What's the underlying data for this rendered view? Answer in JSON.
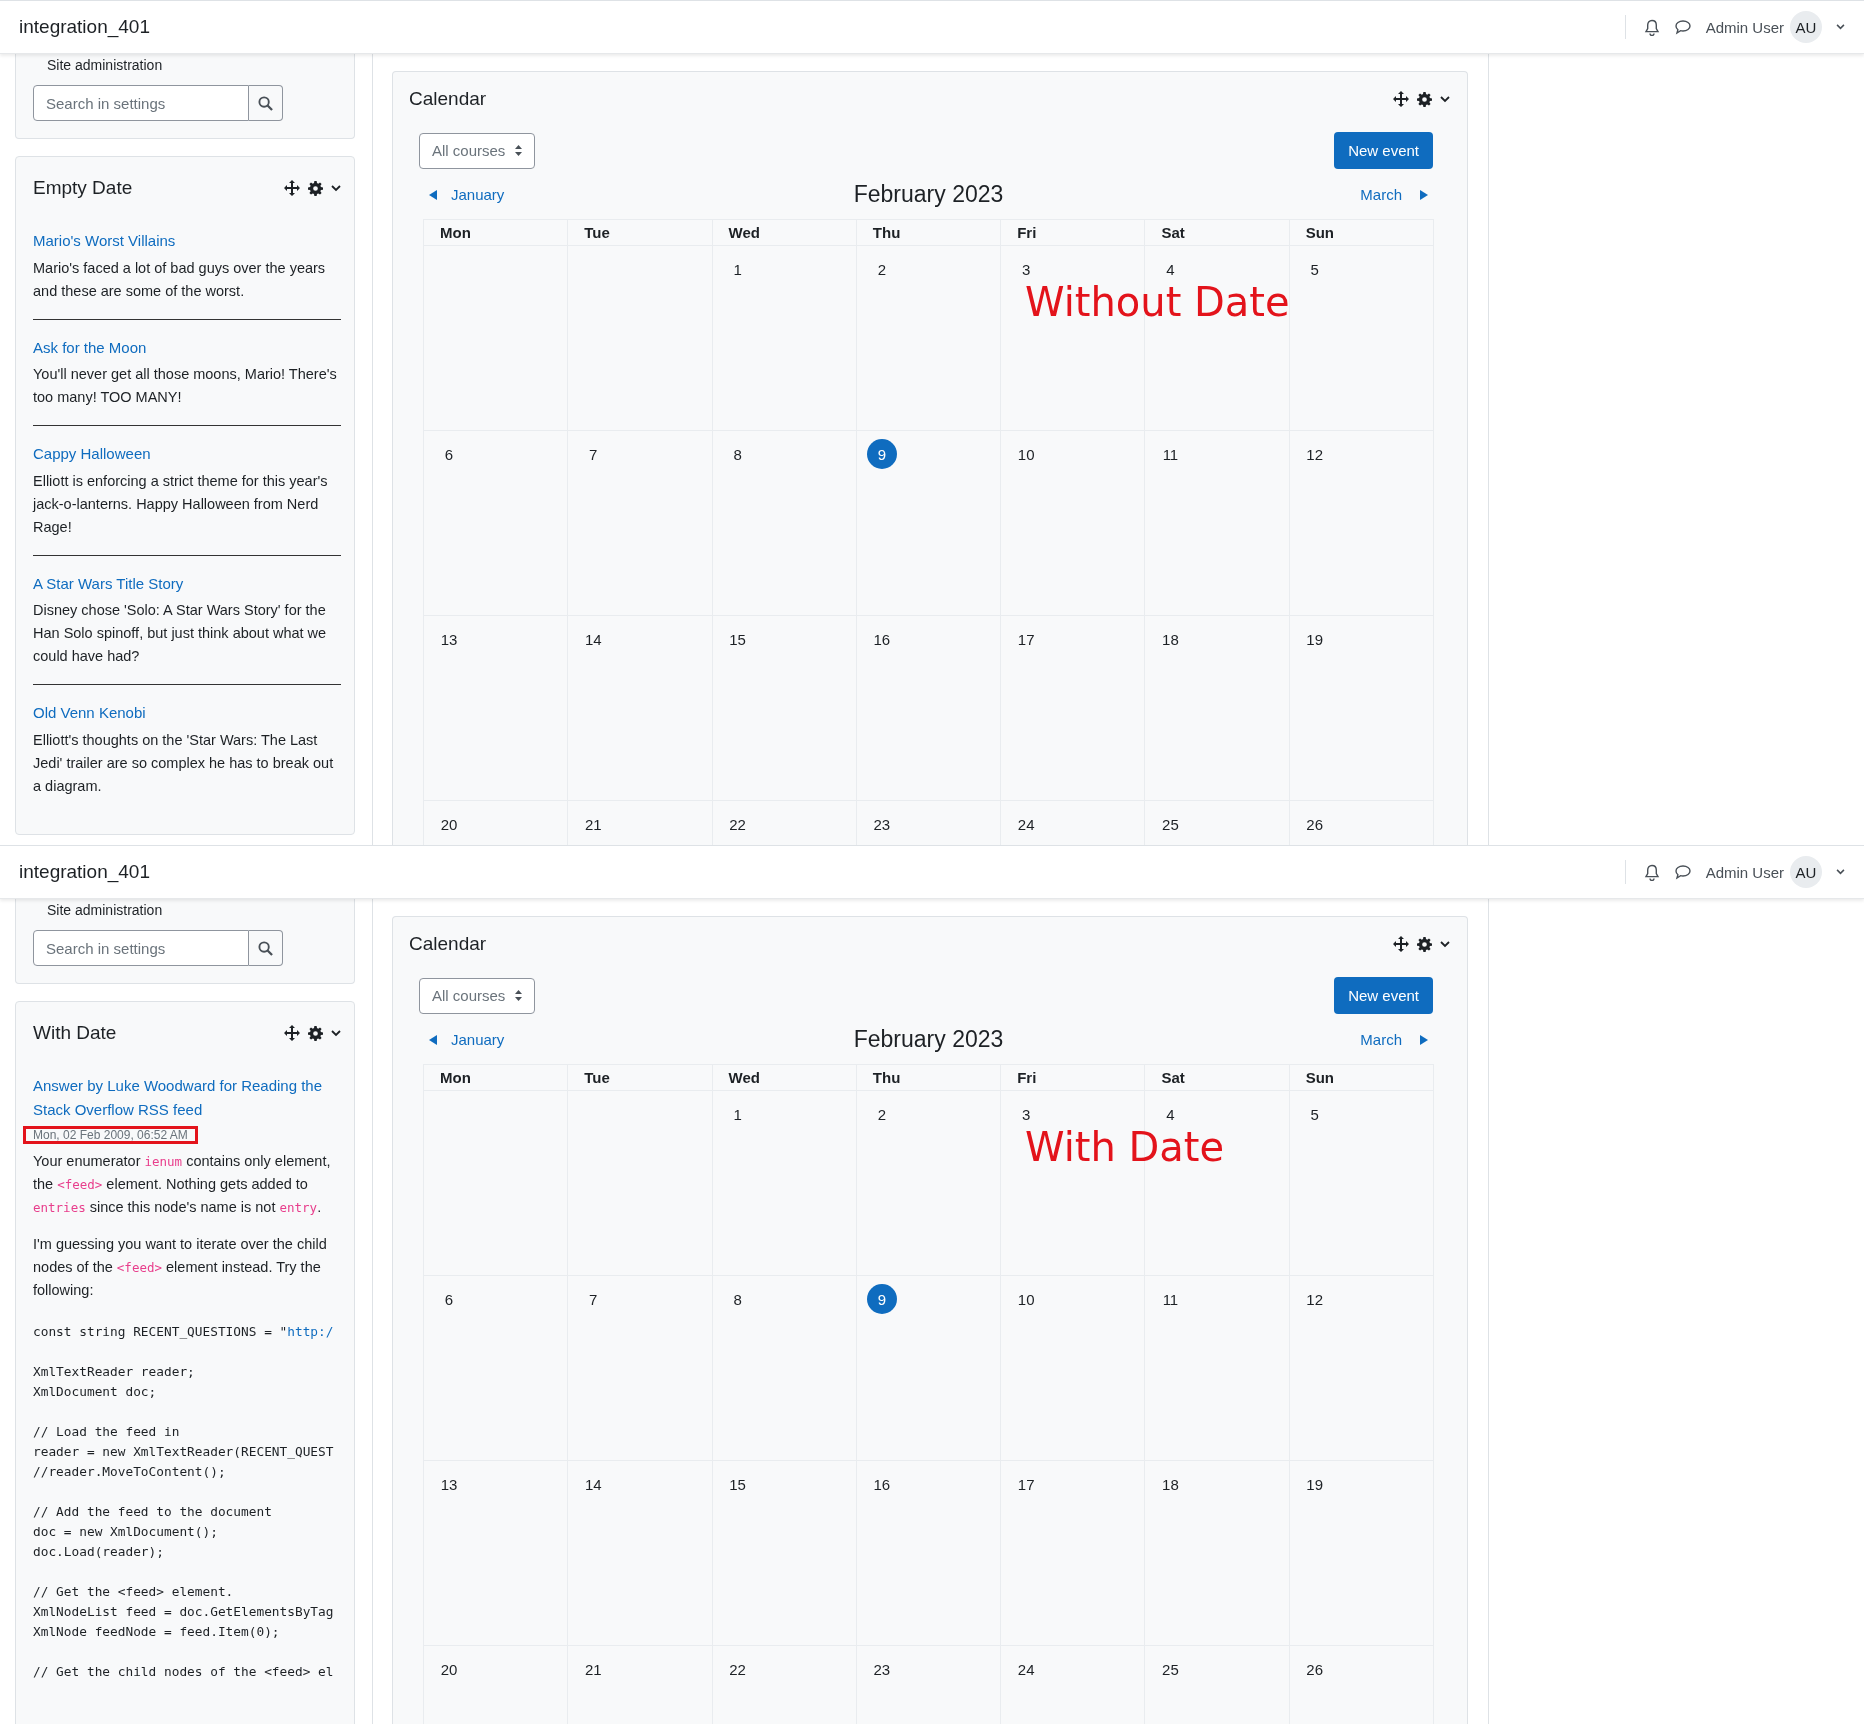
{
  "panes": [
    {
      "header": {
        "site_name": "integration_401",
        "user_name": "Admin User",
        "avatar_initials": "AU"
      },
      "sidebar": {
        "section_link": "Site administration",
        "search_placeholder": "Search in settings",
        "block": {
          "title": "Empty Date",
          "items": [
            {
              "title": "Mario's Worst Villains",
              "body": [
                {
                  "kind": "paragraph",
                  "segments": [
                    {
                      "text": "Mario's faced a lot of bad guys over the years and these are some of the worst.",
                      "code": false
                    }
                  ]
                }
              ]
            },
            {
              "title": "Ask for the Moon",
              "body": [
                {
                  "kind": "paragraph",
                  "segments": [
                    {
                      "text": "You'll never get all those moons, Mario! There's too many! TOO MANY!",
                      "code": false
                    }
                  ]
                }
              ]
            },
            {
              "title": "Cappy Halloween",
              "body": [
                {
                  "kind": "paragraph",
                  "segments": [
                    {
                      "text": "Elliott is enforcing a strict theme for this year's jack-o-lanterns. Happy Halloween from Nerd Rage!",
                      "code": false
                    }
                  ]
                }
              ]
            },
            {
              "title": "A Star Wars Title Story",
              "body": [
                {
                  "kind": "paragraph",
                  "segments": [
                    {
                      "text": "Disney chose 'Solo: A Star Wars Story' for the Han Solo spinoff, but just think about what we could have had?",
                      "code": false
                    }
                  ]
                }
              ]
            },
            {
              "title": "Old Venn Kenobi",
              "body": [
                {
                  "kind": "paragraph",
                  "segments": [
                    {
                      "text": "Elliott's thoughts on the 'Star Wars: The Last Jedi' trailer are so complex he has to break out a diagram.",
                      "code": false
                    }
                  ]
                }
              ]
            }
          ]
        }
      },
      "calendar": {
        "title": "Calendar",
        "course_filter": "All courses",
        "new_event": "New event",
        "prev_month": "January",
        "month": "February 2023",
        "next_month": "March",
        "weekdays": [
          "Mon",
          "Tue",
          "Wed",
          "Thu",
          "Fri",
          "Sat",
          "Sun"
        ],
        "weeks": [
          [
            {
              "kind": "blank"
            },
            {
              "kind": "blank"
            },
            {
              "kind": "day",
              "label": "1",
              "today": false
            },
            {
              "kind": "day",
              "label": "2",
              "today": false
            },
            {
              "kind": "day",
              "label": "3",
              "today": false
            },
            {
              "kind": "day",
              "label": "4",
              "today": false
            },
            {
              "kind": "day",
              "label": "5",
              "today": false
            }
          ],
          [
            {
              "kind": "day",
              "label": "6",
              "today": false
            },
            {
              "kind": "day",
              "label": "7",
              "today": false
            },
            {
              "kind": "day",
              "label": "8",
              "today": false
            },
            {
              "kind": "day",
              "label": "9",
              "today": true
            },
            {
              "kind": "day",
              "label": "10",
              "today": false
            },
            {
              "kind": "day",
              "label": "11",
              "today": false
            },
            {
              "kind": "day",
              "label": "12",
              "today": false
            }
          ],
          [
            {
              "kind": "day",
              "label": "13",
              "today": false
            },
            {
              "kind": "day",
              "label": "14",
              "today": false
            },
            {
              "kind": "day",
              "label": "15",
              "today": false
            },
            {
              "kind": "day",
              "label": "16",
              "today": false
            },
            {
              "kind": "day",
              "label": "17",
              "today": false
            },
            {
              "kind": "day",
              "label": "18",
              "today": false
            },
            {
              "kind": "day",
              "label": "19",
              "today": false
            }
          ],
          [
            {
              "kind": "day",
              "label": "20",
              "today": false
            },
            {
              "kind": "day",
              "label": "21",
              "today": false
            },
            {
              "kind": "day",
              "label": "22",
              "today": false
            },
            {
              "kind": "day",
              "label": "23",
              "today": false
            },
            {
              "kind": "day",
              "label": "24",
              "today": false
            },
            {
              "kind": "day",
              "label": "25",
              "today": false
            },
            {
              "kind": "day",
              "label": "26",
              "today": false
            }
          ]
        ],
        "annotation": "Without Date"
      }
    },
    {
      "header": {
        "site_name": "integration_401",
        "user_name": "Admin User",
        "avatar_initials": "AU"
      },
      "sidebar": {
        "section_link": "Site administration",
        "search_placeholder": "Search in settings",
        "block": {
          "title": "With Date",
          "items": [
            {
              "title": "Answer by Luke Woodward for Reading the Stack Overflow RSS feed",
              "date": {
                "text": "Mon, 02 Feb 2009, 06:52 AM",
                "highlighted": true
              },
              "body": [
                {
                  "kind": "paragraph",
                  "segments": [
                    {
                      "text": "Your enumerator ",
                      "code": false
                    },
                    {
                      "text": "ienum",
                      "code": true
                    },
                    {
                      "text": " contains only element, the ",
                      "code": false
                    },
                    {
                      "text": "<feed>",
                      "code": true
                    },
                    {
                      "text": " element. Nothing gets added to ",
                      "code": false
                    },
                    {
                      "text": "entries",
                      "code": true
                    },
                    {
                      "text": " since this node's name is not ",
                      "code": false
                    },
                    {
                      "text": "entry",
                      "code": true
                    },
                    {
                      "text": ".",
                      "code": false
                    }
                  ]
                },
                {
                  "kind": "paragraph",
                  "segments": [
                    {
                      "text": "I'm guessing you want to iterate over the child nodes of the ",
                      "code": false
                    },
                    {
                      "text": "<feed>",
                      "code": true
                    },
                    {
                      "text": " element instead. Try the following:",
                      "code": false
                    }
                  ]
                },
                {
                  "kind": "code",
                  "groups": [
                    [
                      {
                        "text": "const string RECENT_QUESTIONS = \"",
                        "literal": "http:/"
                      }
                    ],
                    [
                      {
                        "text": "XmlTextReader reader;"
                      },
                      {
                        "text": "XmlDocument doc;"
                      }
                    ],
                    [
                      {
                        "text": "// Load the feed in"
                      },
                      {
                        "text": "reader = new XmlTextReader(RECENT_QUEST"
                      },
                      {
                        "text": "//reader.MoveToContent();"
                      }
                    ],
                    [
                      {
                        "text": "// Add the feed to the document"
                      },
                      {
                        "text": "doc = new XmlDocument();"
                      },
                      {
                        "text": "doc.Load(reader);"
                      }
                    ],
                    [
                      {
                        "text": "// Get the <feed> element."
                      },
                      {
                        "text": "XmlNodeList feed = doc.GetElementsByTag"
                      },
                      {
                        "text": "XmlNode feedNode = feed.Item(0);"
                      }
                    ],
                    [
                      {
                        "text": "// Get the child nodes of the <feed> el"
                      }
                    ]
                  ]
                }
              ]
            }
          ]
        }
      },
      "calendar": {
        "title": "Calendar",
        "course_filter": "All courses",
        "new_event": "New event",
        "prev_month": "January",
        "month": "February 2023",
        "next_month": "March",
        "weekdays": [
          "Mon",
          "Tue",
          "Wed",
          "Thu",
          "Fri",
          "Sat",
          "Sun"
        ],
        "weeks": [
          [
            {
              "kind": "blank"
            },
            {
              "kind": "blank"
            },
            {
              "kind": "day",
              "label": "1",
              "today": false
            },
            {
              "kind": "day",
              "label": "2",
              "today": false
            },
            {
              "kind": "day",
              "label": "3",
              "today": false
            },
            {
              "kind": "day",
              "label": "4",
              "today": false
            },
            {
              "kind": "day",
              "label": "5",
              "today": false
            }
          ],
          [
            {
              "kind": "day",
              "label": "6",
              "today": false
            },
            {
              "kind": "day",
              "label": "7",
              "today": false
            },
            {
              "kind": "day",
              "label": "8",
              "today": false
            },
            {
              "kind": "day",
              "label": "9",
              "today": true
            },
            {
              "kind": "day",
              "label": "10",
              "today": false
            },
            {
              "kind": "day",
              "label": "11",
              "today": false
            },
            {
              "kind": "day",
              "label": "12",
              "today": false
            }
          ],
          [
            {
              "kind": "day",
              "label": "13",
              "today": false
            },
            {
              "kind": "day",
              "label": "14",
              "today": false
            },
            {
              "kind": "day",
              "label": "15",
              "today": false
            },
            {
              "kind": "day",
              "label": "16",
              "today": false
            },
            {
              "kind": "day",
              "label": "17",
              "today": false
            },
            {
              "kind": "day",
              "label": "18",
              "today": false
            },
            {
              "kind": "day",
              "label": "19",
              "today": false
            }
          ],
          [
            {
              "kind": "day",
              "label": "20",
              "today": false
            },
            {
              "kind": "day",
              "label": "21",
              "today": false
            },
            {
              "kind": "day",
              "label": "22",
              "today": false
            },
            {
              "kind": "day",
              "label": "23",
              "today": false
            },
            {
              "kind": "day",
              "label": "24",
              "today": false
            },
            {
              "kind": "day",
              "label": "25",
              "today": false
            },
            {
              "kind": "day",
              "label": "26",
              "today": false
            }
          ]
        ],
        "annotation": "With Date"
      }
    }
  ]
}
